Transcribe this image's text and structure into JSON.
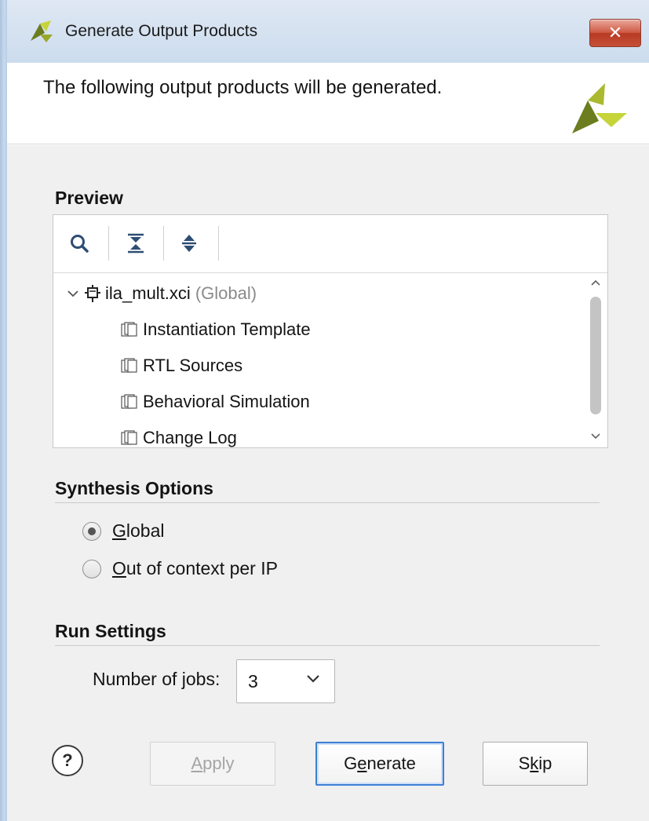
{
  "window": {
    "title": "Generate Output Products",
    "close_symbol": "✕"
  },
  "header": {
    "message": "The following output products will be generated."
  },
  "preview": {
    "section_title": "Preview",
    "toolbar": {
      "icons": [
        "search-icon",
        "collapse-all-icon",
        "expand-all-icon"
      ]
    },
    "tree": {
      "root": {
        "name": "ila_mult.xci",
        "suffix": "(Global)",
        "icon": "ip-core-icon",
        "expanded": true
      },
      "children": [
        {
          "label": "Instantiation Template",
          "icon": "document-stack-icon"
        },
        {
          "label": "RTL Sources",
          "icon": "document-stack-icon"
        },
        {
          "label": "Behavioral Simulation",
          "icon": "document-stack-icon"
        },
        {
          "label": "Change Log",
          "icon": "document-stack-icon"
        }
      ]
    }
  },
  "synthesis_options": {
    "section_title": "Synthesis Options",
    "options": [
      {
        "mnemonic": "G",
        "rest": "lobal",
        "selected": true
      },
      {
        "mnemonic": "O",
        "rest": "ut of context per IP",
        "selected": false
      }
    ]
  },
  "run_settings": {
    "section_title": "Run Settings",
    "jobs_label_pre": "Number of ",
    "jobs_label_mnemonic": "j",
    "jobs_label_post": "obs:",
    "jobs_value": "3"
  },
  "buttons": {
    "help": "?",
    "apply": {
      "mnemonic": "A",
      "rest": "pply",
      "enabled": false
    },
    "generate": {
      "pre": "G",
      "mnemonic": "e",
      "rest": "nerate"
    },
    "skip": {
      "pre": "S",
      "mnemonic": "k",
      "rest": "ip"
    }
  },
  "colors": {
    "accent_focus": "#3e7fd6",
    "logo_green_dark": "#6b7d1e",
    "logo_green_light": "#c6d43a",
    "close_red": "#c65038"
  }
}
